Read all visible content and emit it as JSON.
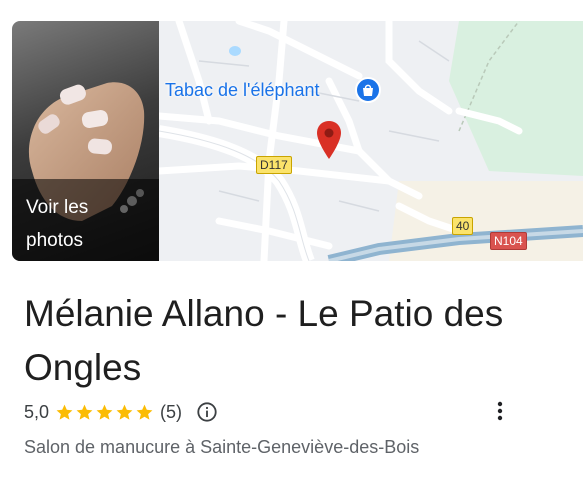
{
  "photo": {
    "label_line1": "Voir les",
    "label_line2": "photos"
  },
  "map": {
    "poi_label": "Tabac de l'éléphant",
    "roads": {
      "d117": "D117",
      "r40": "40",
      "n104": "N104"
    }
  },
  "place": {
    "title": "Mélanie Allano - Le Patio des Ongles",
    "rating": "5,0",
    "stars": 5,
    "review_count": "(5)",
    "category": "Salon de manucure à Sainte-Geneviève-des-Bois"
  },
  "colors": {
    "star": "#fbbc04",
    "poi_blue": "#1a73e8",
    "pin_red": "#d93025"
  },
  "icons": [
    "shopping-bag-icon",
    "map-pin-icon",
    "star-icon",
    "info-icon",
    "more-vertical-icon"
  ]
}
